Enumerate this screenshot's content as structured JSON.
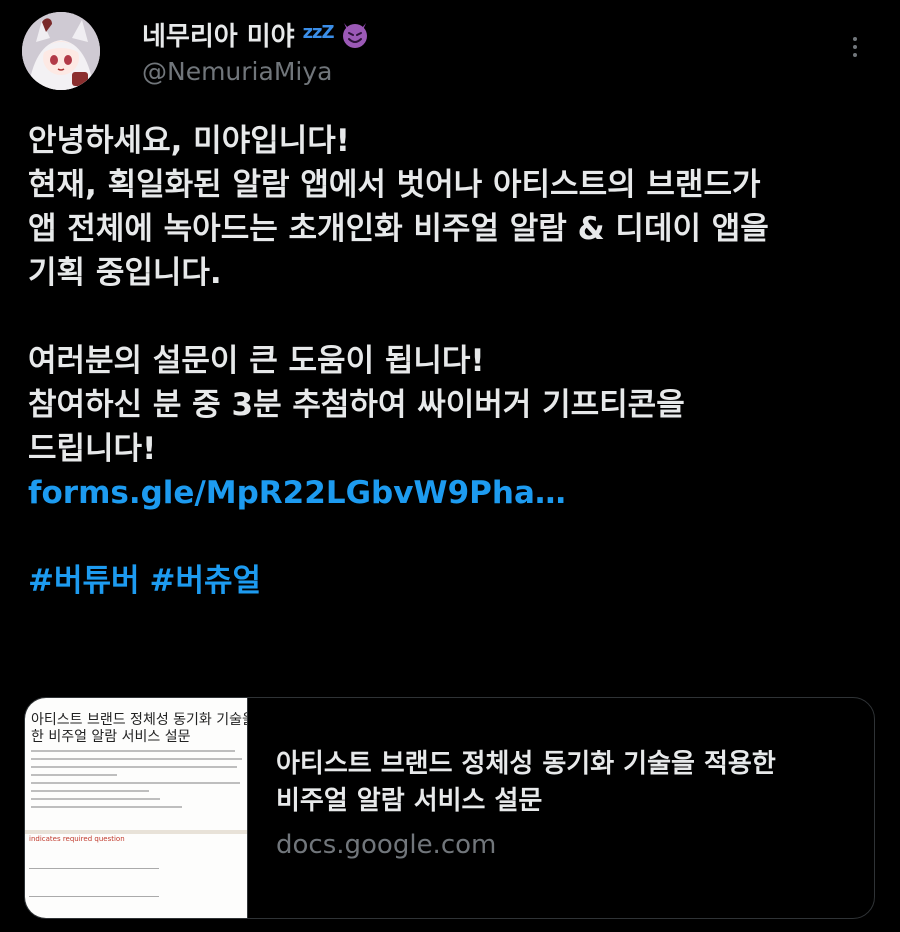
{
  "author": {
    "display_name": "네무리아 미야",
    "sleep_badge": "zzZ",
    "handle": "@NemuriaMiya",
    "avatar_icon": "anime-avatar-icon"
  },
  "tweet": {
    "lines": [
      "안녕하세요, 미야입니다!",
      "현재, 획일화된 알람 앱에서 벗어나 아티스트의 브랜드가",
      "앱 전체에 녹아드는 초개인화 비주얼 알람 & 디데이 앱을",
      "기획 중입니다."
    ],
    "lines2": [
      "여러분의 설문이 큰 도움이 됩니다!",
      "참여하신 분 중 3분 추첨하여 싸이버거 기프티콘을",
      "드립니다!"
    ],
    "link": "forms.gle/MpR22LGbvW9Pha…",
    "hashtags": [
      "#버튜버",
      "#버츄얼"
    ]
  },
  "card": {
    "thumbnail_title": "아티스트 브랜드 정체성 동기화 기술을",
    "thumbnail_subtitle": "한 비주얼 알람 서비스 설문",
    "thumbnail_required": "indicates required question",
    "title_line1": "아티스트 브랜드 정체성 동기화 기술을 적용한",
    "title_line2": "비주얼 알람 서비스 설문",
    "domain": "docs.google.com"
  },
  "colors": {
    "background": "#000000",
    "text": "#e7e9ea",
    "muted": "#71767b",
    "link": "#1d9bf0",
    "border": "#2f3336"
  }
}
